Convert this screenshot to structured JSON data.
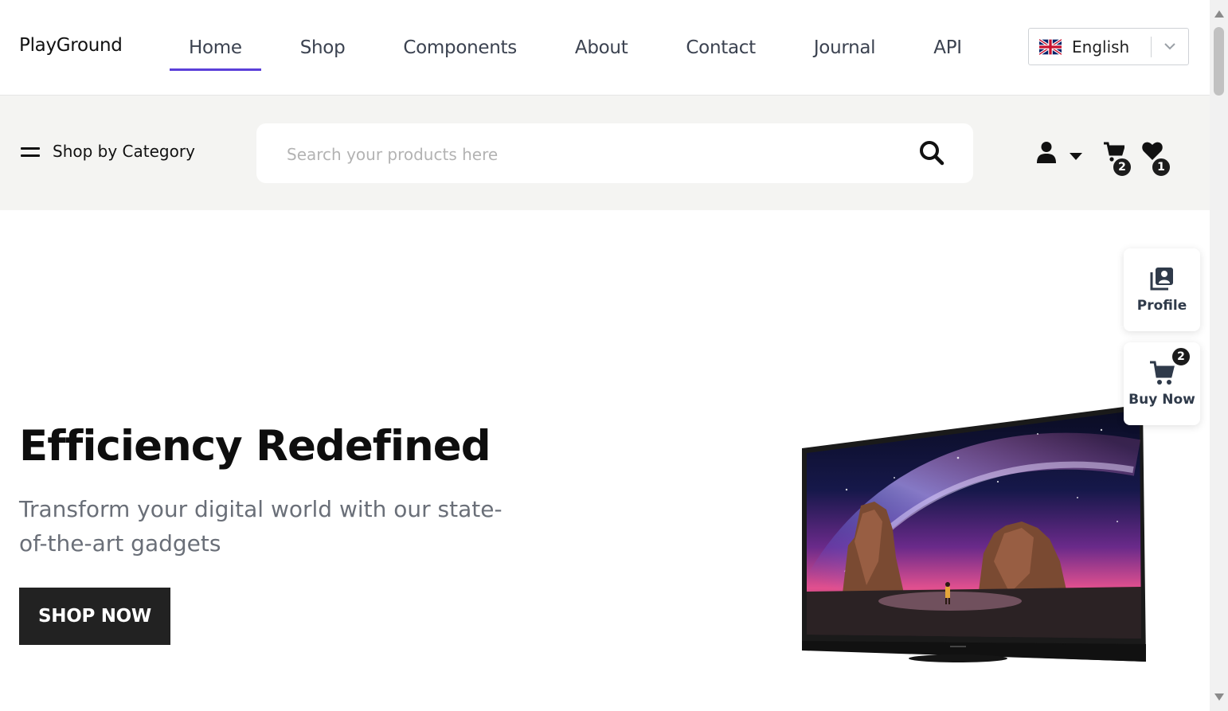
{
  "brand": "PlayGround",
  "nav": {
    "items": [
      {
        "label": "Home",
        "active": true
      },
      {
        "label": "Shop",
        "active": false
      },
      {
        "label": "Components",
        "active": false
      },
      {
        "label": "About",
        "active": false
      },
      {
        "label": "Contact",
        "active": false
      },
      {
        "label": "Journal",
        "active": false
      },
      {
        "label": "API",
        "active": false
      }
    ],
    "active_color": "#5b3fd9"
  },
  "language": {
    "selected": "English",
    "flag": "uk-flag-icon"
  },
  "category": {
    "label": "Shop by Category"
  },
  "search": {
    "placeholder": "Search your products here"
  },
  "icons": {
    "user": "user-icon",
    "caret": "caret-down-icon",
    "cart": "cart-icon",
    "wishlist": "heart-icon"
  },
  "counts": {
    "cart": "2",
    "wishlist": "1"
  },
  "hero": {
    "title": "Efficiency Redefined",
    "subtitle": "Transform your digital world with our state-of-the-art gadgets",
    "cta": "SHOP NOW"
  },
  "floating": {
    "profile_label": "Profile",
    "buy_label": "Buy Now",
    "buy_count": "2"
  }
}
